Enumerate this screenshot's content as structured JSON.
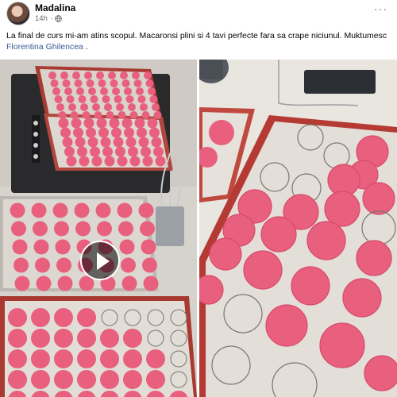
{
  "post": {
    "author": "Madalina",
    "time": "14h",
    "dot": "·",
    "more": "···",
    "text_before_mention": "La final de curs mi-am atins scopul. Macaronsi plini si 4 tavi perfecte fara sa crape niciunul. Muktumesc ",
    "mention": "Florentina Ghilencea",
    "text_after_mention": " ."
  },
  "media": {
    "left_photo": "photo-macarons-on-trays",
    "right_photo": "video-macarons-closeup",
    "play_icon": "play-icon"
  },
  "colors": {
    "macaron": "#e8607e",
    "macaron_dark": "#d84a6a",
    "mat": "#c2453a",
    "mention": "#385898",
    "meta": "#65676b"
  }
}
